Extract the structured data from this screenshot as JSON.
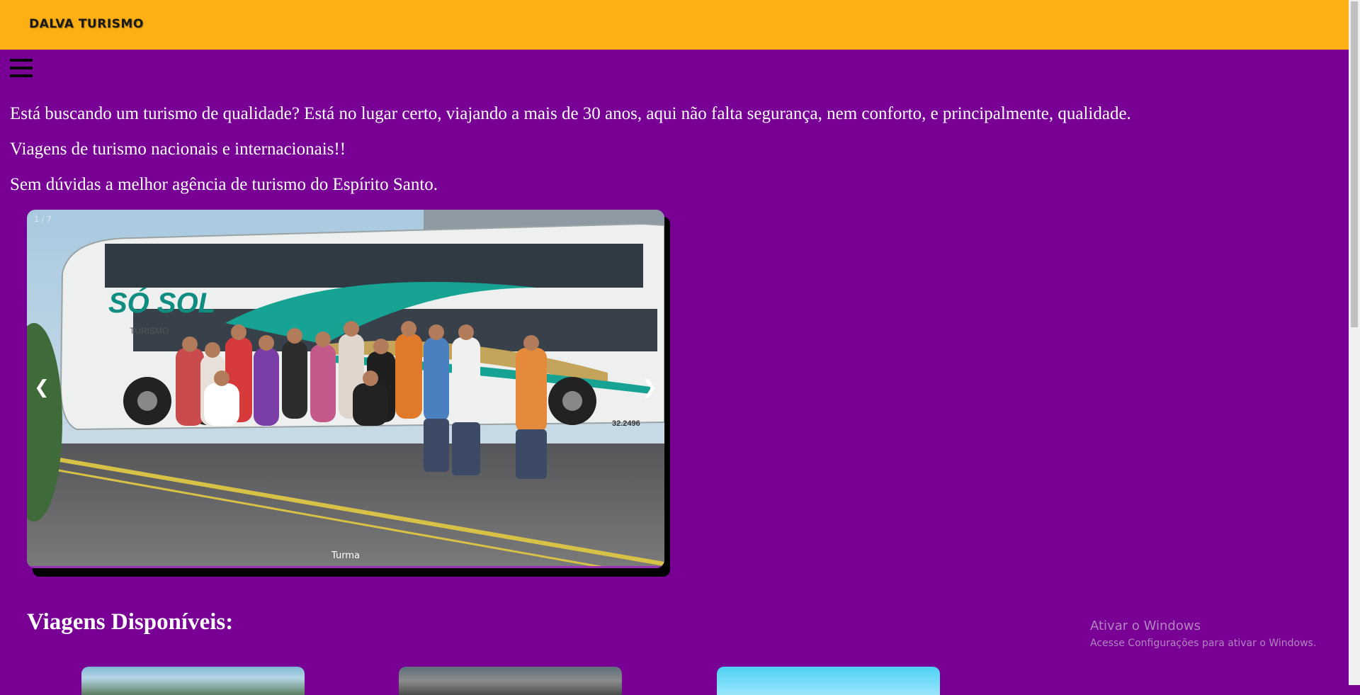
{
  "header": {
    "brand": "DALVA TURISMO"
  },
  "intro": {
    "lines": [
      "Está buscando um turismo de qualidade? Está no lugar certo, viajando a mais de 30 anos, aqui não falta segurança, nem conforto, e principalmente, qualidade.",
      "Viagens de turismo nacionais e internacionais!!",
      "Sem dúvidas a melhor agência de turismo do Espírito Santo."
    ]
  },
  "carousel": {
    "counter": "1 / 7",
    "prev": "❮",
    "next": "❯",
    "caption": "Turma",
    "photo_text": {
      "bus_brand": "SÓ SOL",
      "bus_sub": "TURISMO",
      "bus_number": "32.2496"
    }
  },
  "trips": {
    "title": "Viagens Disponíveis:"
  },
  "watermark": {
    "title": "Ativar o Windows",
    "subtitle": "Acesse Configurações para ativar o Windows."
  },
  "colors": {
    "header": "#fdb014",
    "background": "#780095",
    "text": "#ffffff"
  }
}
